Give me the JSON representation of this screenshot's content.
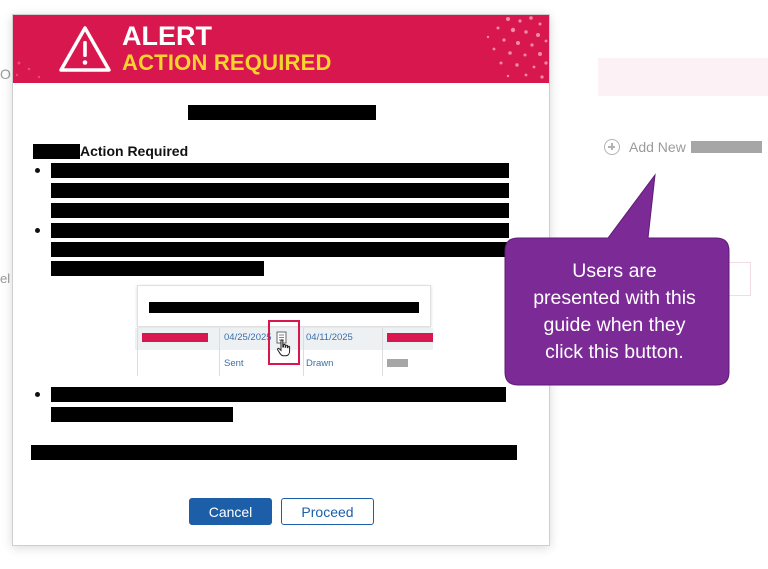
{
  "background": {
    "partial_left_text_top": "O",
    "partial_left_text_mid": "el",
    "add_new_label": "Add New"
  },
  "modal": {
    "banner": {
      "title": "ALERT",
      "subtitle": "ACTION REQUIRED",
      "color": "#d8174f",
      "subtitle_color": "#f5d42e"
    },
    "heading": "Action Required",
    "example_screenshot": {
      "date_1": "04/25/2025",
      "date_2": "04/11/2025",
      "status_1": "Sent",
      "status_2": "Drawn"
    },
    "cancel_label": "Cancel",
    "proceed_label": "Proceed"
  },
  "callout": {
    "line_1": "Users are",
    "line_2": "presented with this",
    "line_3": "guide when they",
    "line_4": "click this button.",
    "color": "#7b2a96"
  }
}
